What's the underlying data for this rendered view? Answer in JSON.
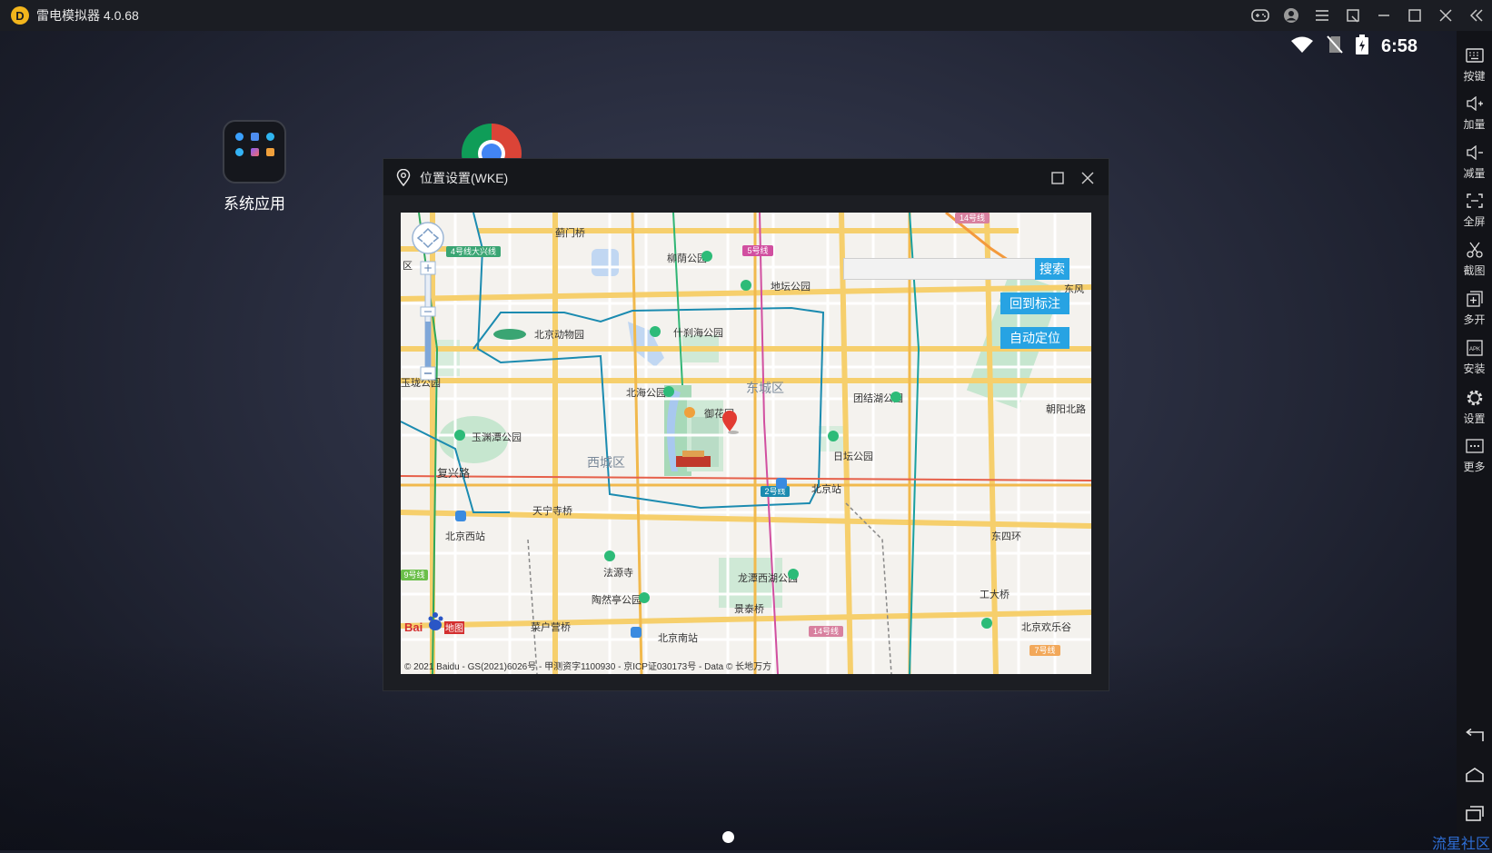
{
  "app": {
    "title": "雷电模拟器 4.0.68",
    "logo_letter": "D"
  },
  "status_bar": {
    "time": "6:58",
    "accent": "#ffffff"
  },
  "sidebar": {
    "items": [
      {
        "label": "按键",
        "icon": "keyboard-icon"
      },
      {
        "label": "加量",
        "icon": "volume-up-icon"
      },
      {
        "label": "减量",
        "icon": "volume-down-icon"
      },
      {
        "label": "全屏",
        "icon": "fullscreen-icon"
      },
      {
        "label": "截图",
        "icon": "scissors-icon"
      },
      {
        "label": "多开",
        "icon": "multi-instance-icon"
      },
      {
        "label": "安装",
        "icon": "apk-icon"
      },
      {
        "label": "设置",
        "icon": "gear-icon"
      },
      {
        "label": "更多",
        "icon": "more-icon"
      }
    ]
  },
  "desktop": {
    "apps": [
      {
        "label": "系统应用",
        "icon": "system-apps-folder-icon"
      },
      {
        "label": "",
        "icon": "chrome-icon"
      }
    ]
  },
  "dialog": {
    "title": "位置设置(WKE)",
    "search_button": "搜索",
    "search_placeholder": "",
    "back_to_marker_button": "回到标注",
    "auto_locate_button": "自动定位",
    "copyright": "© 2021 Baidu - GS(2021)6026号 - 甲测资字1100930 - 京ICP证030173号 - Data © 长地万方",
    "baidu_logo": "Bai du 地图",
    "button_color": "#27a3e3"
  },
  "map": {
    "districts": [
      "东城区",
      "西城区"
    ],
    "places": [
      "蓟门桥",
      "柳荫公园",
      "地坛公园",
      "北京动物园",
      "什刹海公园",
      "北海公园",
      "御花园",
      "团结湖公园",
      "玉渊潭公园",
      "日坛公园",
      "北京站",
      "天宁寺桥",
      "北京西站",
      "法源寺",
      "龙潭西湖公园",
      "陶然亭公园",
      "景泰桥",
      "菜户营桥",
      "北京南站",
      "工大桥",
      "北京欢乐谷",
      "朝阳北路",
      "复兴路",
      "东四环",
      "东风"
    ],
    "line_badges": [
      "4号线大兴线",
      "5号线",
      "14号线",
      "2号线",
      "9号线",
      "14号线",
      "7号线"
    ],
    "edge_labels": [
      "区",
      "玉珑公园"
    ]
  },
  "footer": {
    "corner_text": "流星社区"
  }
}
